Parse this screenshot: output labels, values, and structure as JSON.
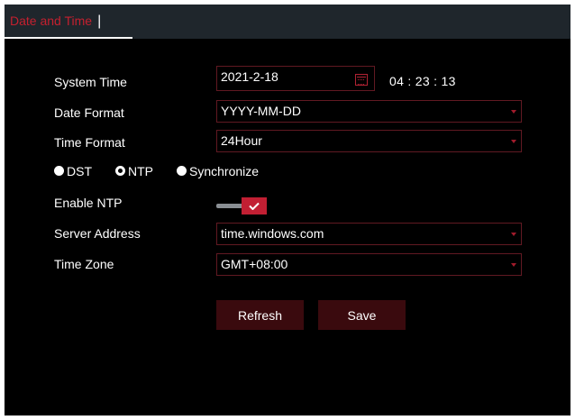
{
  "tab": {
    "title": "Date and Time",
    "separator": "|"
  },
  "form": {
    "system_time": {
      "label": "System Time",
      "date": "2021-2-18",
      "time": "04 : 23 : 13"
    },
    "date_format": {
      "label": "Date Format",
      "value": "YYYY-MM-DD"
    },
    "time_format": {
      "label": "Time Format",
      "value": "24Hour"
    },
    "sync_mode": {
      "options": [
        "DST",
        "NTP",
        "Synchronize"
      ],
      "selected": "NTP"
    },
    "enable_ntp": {
      "label": "Enable NTP",
      "checked": true
    },
    "server_address": {
      "label": "Server Address",
      "value": "time.windows.com"
    },
    "time_zone": {
      "label": "Time Zone",
      "value": "GMT+08:00"
    }
  },
  "buttons": {
    "refresh": "Refresh",
    "save": "Save"
  },
  "colors": {
    "accent": "#c21f33",
    "tab_bar": "#1f262c",
    "field_border": "#611922",
    "button_bg": "#3a0a0e"
  },
  "icons": {
    "date_picker": "calendar-icon",
    "enabled_toggle": "checkmark-icon",
    "dropdown": "caret-down-icon"
  }
}
